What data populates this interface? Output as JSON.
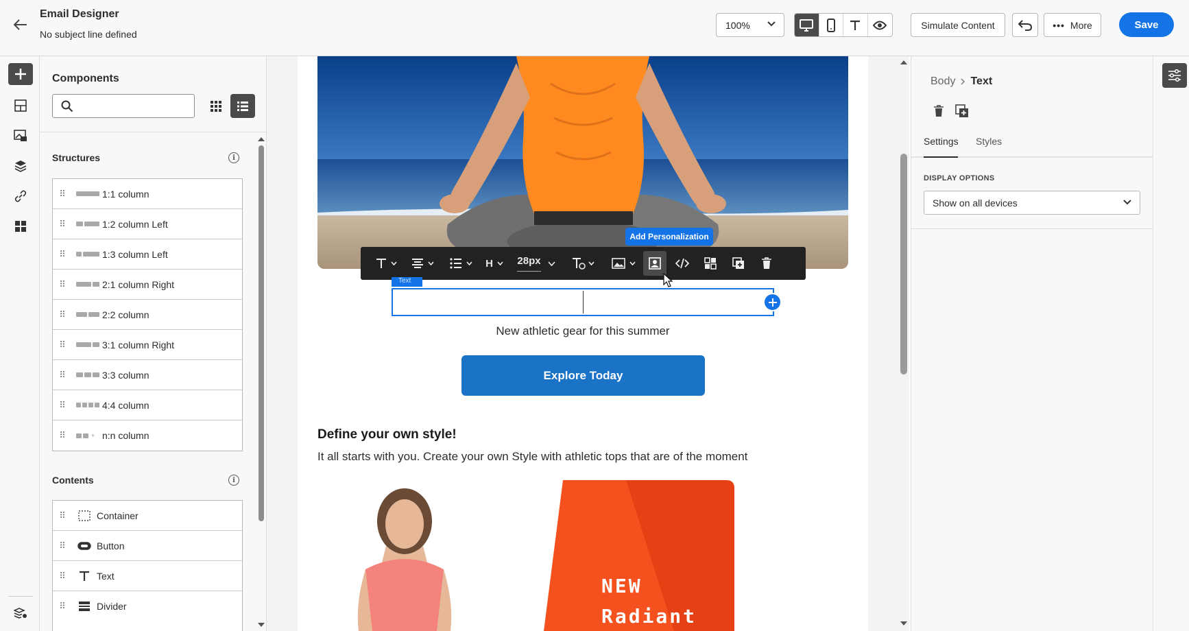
{
  "header": {
    "title": "Email Designer",
    "subject": "No subject line defined",
    "zoom": "100%",
    "simulate_label": "Simulate Content",
    "more_label": "More",
    "save_label": "Save"
  },
  "components": {
    "title": "Components",
    "search_placeholder": "",
    "structures_title": "Structures",
    "structures": [
      {
        "label": "1:1 column"
      },
      {
        "label": "1:2 column Left"
      },
      {
        "label": "1:3 column Left"
      },
      {
        "label": "2:1 column Right"
      },
      {
        "label": "2:2 column"
      },
      {
        "label": "3:1 column Right"
      },
      {
        "label": "3:3 column"
      },
      {
        "label": "4:4 column"
      },
      {
        "label": "n:n column"
      }
    ],
    "contents_title": "Contents",
    "contents": [
      {
        "label": "Container",
        "icon": "container-icon"
      },
      {
        "label": "Button",
        "icon": "button-icon"
      },
      {
        "label": "Text",
        "icon": "text-icon"
      },
      {
        "label": "Divider",
        "icon": "divider-icon"
      }
    ]
  },
  "canvas": {
    "toolbar": {
      "heading": "H",
      "font_size": "28px",
      "tooltip": "Add Personalization"
    },
    "text_tag": "Text",
    "tagline": "New athletic gear for this summer",
    "cta_label": "Explore Today",
    "heading2": "Define your own style!",
    "paragraph": "It all starts with you. Create your own Style with athletic tops that are of the moment",
    "promo_line1": "NEW",
    "promo_line2": "Radiant"
  },
  "properties": {
    "breadcrumb_parent": "Body",
    "breadcrumb_current": "Text",
    "tab_settings": "Settings",
    "tab_styles": "Styles",
    "display_options_label": "DISPLAY OPTIONS",
    "display_value": "Show on all devices"
  },
  "colors": {
    "accent": "#1473e6",
    "cta": "#1b73c8",
    "promo_orange": "#f4511e"
  }
}
